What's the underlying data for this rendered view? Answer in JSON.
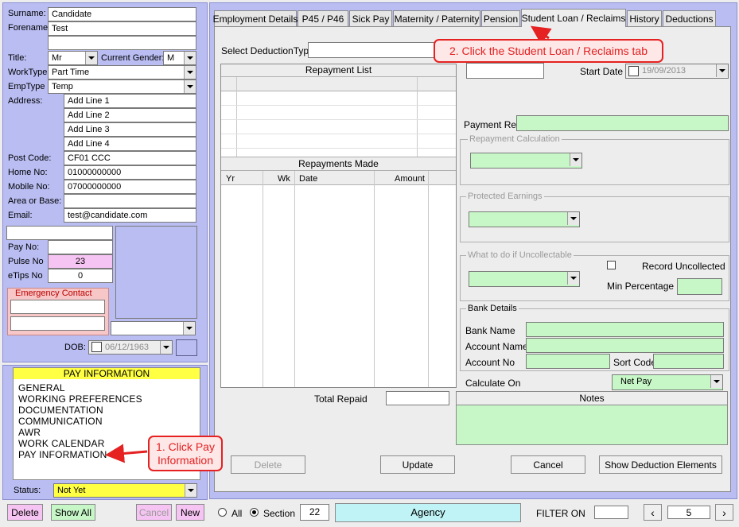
{
  "employee": {
    "surname_label": "Surname:",
    "surname": "Candidate",
    "forename_label": "Forename:",
    "forename": "Test",
    "title_label": "Title:",
    "title": "Mr",
    "gender_label": "Current Gender:",
    "gender": "M",
    "worktype_label": "WorkType",
    "worktype": "Part Time",
    "emptype_label": "EmpType",
    "emptype": "Temp",
    "address_label": "Address:",
    "address_lines": [
      "Add Line 1",
      "Add Line 2",
      "Add Line 3",
      "Add Line 4"
    ],
    "postcode_label": "Post Code:",
    "postcode": "CF01 CCC",
    "homeno_label": "Home No:",
    "homeno": "01000000000",
    "mobileno_label": "Mobile No:",
    "mobileno": "07000000000",
    "area_label": "Area or Base:",
    "area": "",
    "email_label": "Email:",
    "email": "test@candidate.com",
    "payno_label": "Pay No:",
    "payno": "",
    "pulseno_label": "Pulse No",
    "pulseno": "23",
    "etips_label": "eTips No",
    "etips": "0",
    "emergency_label": "Emergency Contact",
    "dob_label": "DOB:",
    "dob": "06/12/1963"
  },
  "nav": {
    "header": "PAY INFORMATION",
    "items": [
      "GENERAL",
      "WORKING PREFERENCES",
      "DOCUMENTATION",
      "COMMUNICATION",
      "AWR",
      "WORK CALENDAR",
      "PAY INFORMATION"
    ],
    "status_label": "Status:",
    "status": "Not Yet"
  },
  "tabs": [
    "Employment Details",
    "P45 / P46",
    "Sick Pay",
    "Maternity / Paternity",
    "Pension",
    "Student Loan / Reclaims",
    "History",
    "Deductions"
  ],
  "form": {
    "select_deduction_label": "Select DeductionType",
    "repayment_list_title": "Repayment List",
    "repayments_made_title": "Repayments Made",
    "repayments_columns": [
      "Yr",
      "Wk",
      "Date",
      "Amount"
    ],
    "total_repaid_label": "Total Repaid",
    "start_date_label": "Start Date",
    "start_date": "19/09/2013",
    "payment_ref_label": "Payment Ref",
    "repayment_calc_label": "Repayment Calculation",
    "protected_earnings_label": "Protected Earnings",
    "uncollectable_label": "What to do if Uncollectable",
    "record_uncollected_label": "Record Uncollected",
    "min_percentage_label": "Min Percentage",
    "bank_details_label": "Bank Details",
    "bank_name_label": "Bank Name",
    "account_name_label": "Account Name",
    "account_no_label": "Account No",
    "sort_code_label": "Sort Code",
    "calculate_on_label": "Calculate On",
    "calculate_on": "Net Pay",
    "notes_label": "Notes"
  },
  "buttons": {
    "delete": "Delete",
    "update": "Update",
    "cancel": "Cancel",
    "show_elements": "Show Deduction Elements"
  },
  "bottom": {
    "delete": "Delete",
    "show_all": "Show All",
    "cancel": "Cancel",
    "new": "New",
    "all_label": "All",
    "section_label": "Section",
    "section_value": "22",
    "agency": "Agency",
    "filter_label": "FILTER ON",
    "page": "5"
  },
  "callouts": {
    "step1": "1. Click Pay Information",
    "step2": "2. Click the Student Loan / Reclaims tab"
  },
  "colors": {
    "panel": "#b9bdf2",
    "highlight_yellow": "#ffff44",
    "pink": "#f6c4f2",
    "green": "#c7f7c7",
    "callout": "#e52121",
    "agency": "#bff3f6"
  }
}
